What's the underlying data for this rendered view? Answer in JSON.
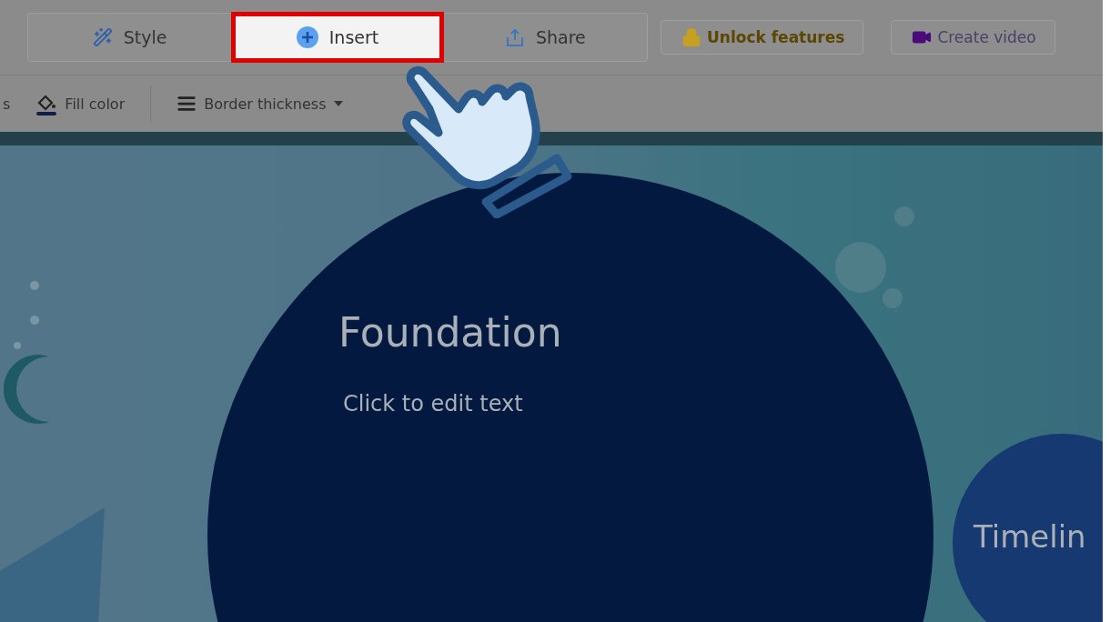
{
  "tabs": [
    {
      "label": "Style",
      "kind": "wand",
      "selected": false
    },
    {
      "label": "Insert",
      "kind": "plus",
      "selected": true
    },
    {
      "label": "Share",
      "kind": "share",
      "selected": false
    }
  ],
  "actions": [
    {
      "label": "Unlock features",
      "kind": "unlock"
    },
    {
      "label": "Create video",
      "kind": "video"
    }
  ],
  "toolbar": [
    {
      "label": "s",
      "kind": "text"
    },
    {
      "label": "Fill color",
      "kind": "fill"
    },
    {
      "label": "Border thickness",
      "kind": "border",
      "dropdown": true
    }
  ],
  "canvas": {
    "main_circle": {
      "title": "Foundation",
      "subtitle": "Click to edit text"
    },
    "side_circle": {
      "title": "Timelin"
    }
  }
}
